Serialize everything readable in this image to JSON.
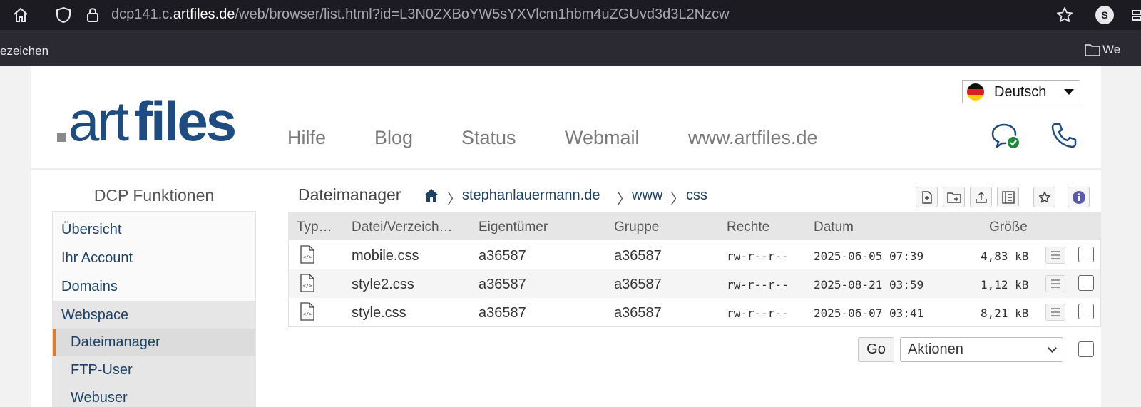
{
  "browser": {
    "url_prefix": "dcp141.c.",
    "url_host": "artfiles.de",
    "url_path": "/web/browser/list.html?id=L3N0ZXBoYW5sYXVlcm1hbm4uZGUvd3d3L2Nzcw",
    "profile_initial": "S",
    "bookmarks_left": "ezeichen",
    "bookmarks_right": "We"
  },
  "header": {
    "logo_art": "art",
    "logo_files": "files",
    "nav": [
      "Hilfe",
      "Blog",
      "Status",
      "Webmail",
      "www.artfiles.de"
    ],
    "language": "Deutsch"
  },
  "sidebar": {
    "title": "DCP Funktionen",
    "items": [
      "Übersicht",
      "Ihr Account",
      "Domains",
      "Webspace"
    ],
    "subitems": [
      "Dateimanager",
      "FTP-User",
      "Webuser"
    ]
  },
  "filemanager": {
    "title": "Dateimanager",
    "breadcrumbs": [
      "stephanlauermann.de",
      "www",
      "css"
    ],
    "columns": [
      "Typ…",
      "Datei/Verzeich…",
      "Eigentümer",
      "Gruppe",
      "Rechte",
      "Datum",
      "Größe"
    ],
    "rows": [
      {
        "name": "mobile.css",
        "owner": "a36587",
        "group": "a36587",
        "perms": "rw-r--r--",
        "date": "2025-06-05 07:39",
        "size": "4,83 kB"
      },
      {
        "name": "style2.css",
        "owner": "a36587",
        "group": "a36587",
        "perms": "rw-r--r--",
        "date": "2025-08-21 03:59",
        "size": "1,12 kB"
      },
      {
        "name": "style.css",
        "owner": "a36587",
        "group": "a36587",
        "perms": "rw-r--r--",
        "date": "2025-06-07 03:41",
        "size": "8,21 kB"
      }
    ],
    "go_label": "Go",
    "actions_label": "Aktionen"
  },
  "colors": {
    "brand": "#1e4b80",
    "link": "#1e3f66",
    "accent": "#e87722",
    "info": "#5a5aa8"
  }
}
